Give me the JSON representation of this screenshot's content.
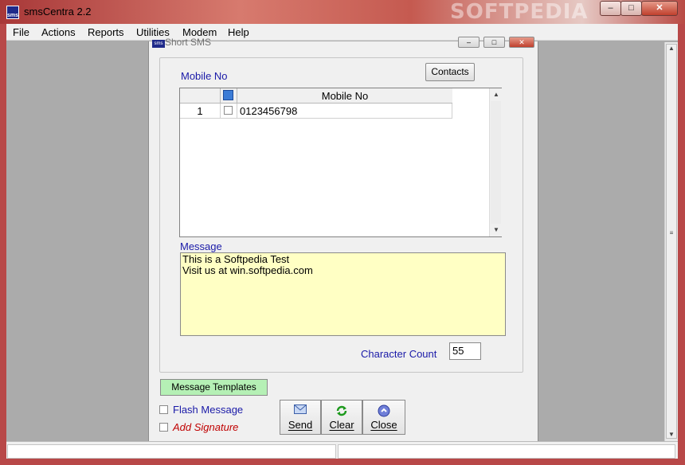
{
  "window": {
    "title": "smsCentra 2.2",
    "app_icon_text": "sms",
    "watermark": "SOFTPEDIA",
    "controls": {
      "minimize": "–",
      "maximize": "□",
      "close": "✕"
    }
  },
  "menu": [
    "File",
    "Actions",
    "Reports",
    "Utilities",
    "Modem",
    "Help"
  ],
  "dialog": {
    "title": "Short SMS",
    "icon_text": "sms",
    "controls": {
      "minimize": "–",
      "maximize": "□",
      "close": "✕"
    },
    "mobile_label": "Mobile No",
    "contacts_button": "Contacts",
    "grid": {
      "header_mobile": "Mobile No",
      "rows": [
        {
          "num": "1",
          "checked": false,
          "mobile": "0123456798"
        }
      ]
    },
    "message_label": "Message",
    "message_text": "This is a Softpedia Test\nVisit us at win.softpedia.com",
    "char_count_label": "Character Count",
    "char_count_value": "55",
    "templates_button": "Message Templates",
    "flash_label": "Flash Message",
    "signature_label": "Add Signature",
    "actions": {
      "send": "Send",
      "clear": "Clear",
      "close": "Close"
    }
  },
  "colors": {
    "label_blue": "#1a1aa8",
    "signature_red": "#c00000",
    "message_bg": "#ffffc4",
    "templates_bg": "#b5f0b5"
  },
  "icons": {
    "send": "envelope-icon",
    "clear": "refresh-icon",
    "close": "close-circle-icon",
    "grid_select": "grid-select-icon"
  }
}
